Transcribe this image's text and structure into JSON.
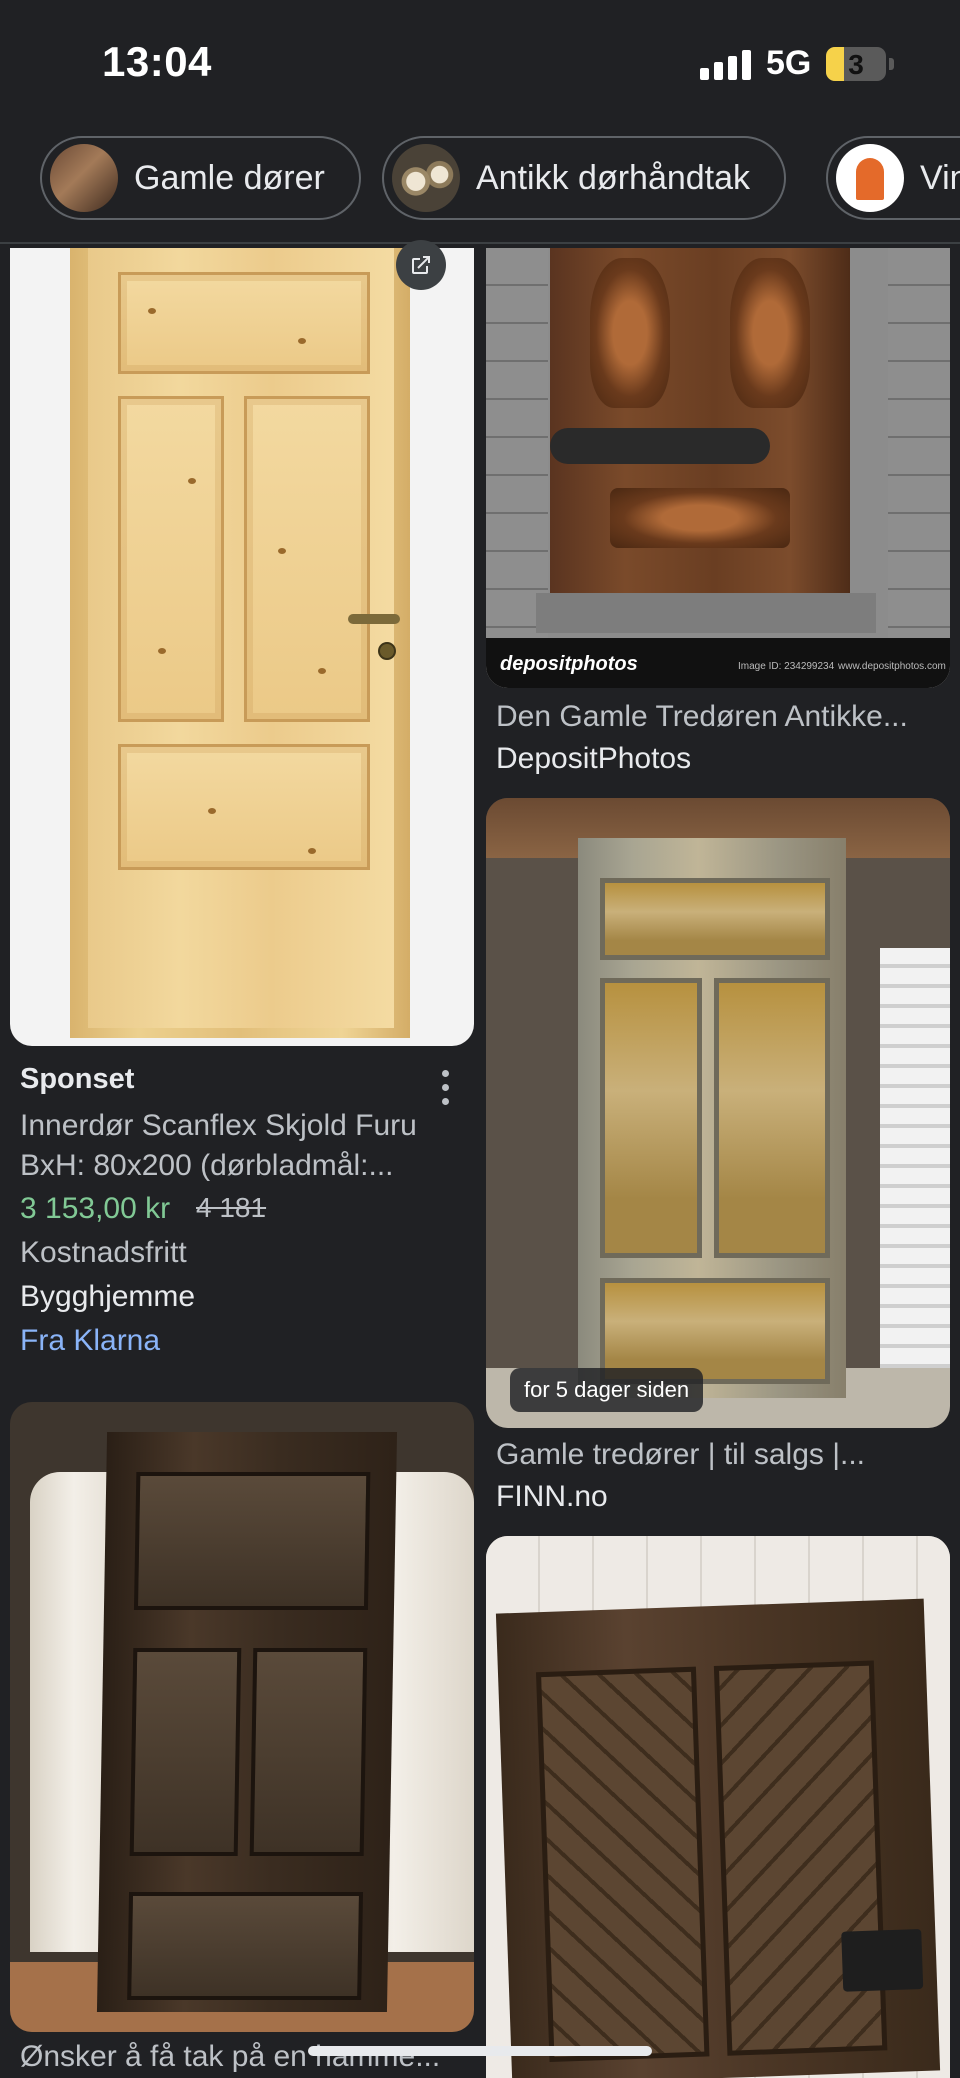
{
  "status_bar": {
    "time": "13:04",
    "network": "5G",
    "battery": "3",
    "battery_level": 0.3
  },
  "chips": [
    {
      "label": "Gamle dører",
      "thumb_icon": "old-doors-thumbnail"
    },
    {
      "label": "Antikk dørhåndtak",
      "thumb_icon": "door-handles-thumbnail"
    },
    {
      "label": "Vin",
      "thumb_icon": "orange-arch-door-thumbnail"
    }
  ],
  "results": {
    "left": [
      {
        "sponsored_label": "Sponset",
        "title": "Innerdør Scanflex Skjold Furu BxH: 80x200 (dørbladmål:...",
        "price": "3 153,00 kr",
        "old_price": "4 181",
        "shipping": "Kostnadsfritt",
        "merchant": "Bygghjemme",
        "payment": "Fra Klarna",
        "open_icon": "open-in-new-icon",
        "menu_icon": "more-vert-icon"
      },
      {
        "title": "Ønsker å få tak på en hamme..."
      }
    ],
    "right": [
      {
        "title": "Den Gamle Tredøren Antikke...",
        "source": "DepositPhotos",
        "watermark_logo": "depositphotos",
        "watermark_id": "Image ID: 234299234",
        "watermark_url": "www.depositphotos.com"
      },
      {
        "badge": "for 5 dager siden",
        "title": "Gamle tredører | til salgs |...",
        "source": "FINN.no"
      },
      {
        "title": ""
      }
    ]
  },
  "colors": {
    "background": "#202124",
    "price_green": "#81c995",
    "link_blue": "#8ab4f8"
  }
}
